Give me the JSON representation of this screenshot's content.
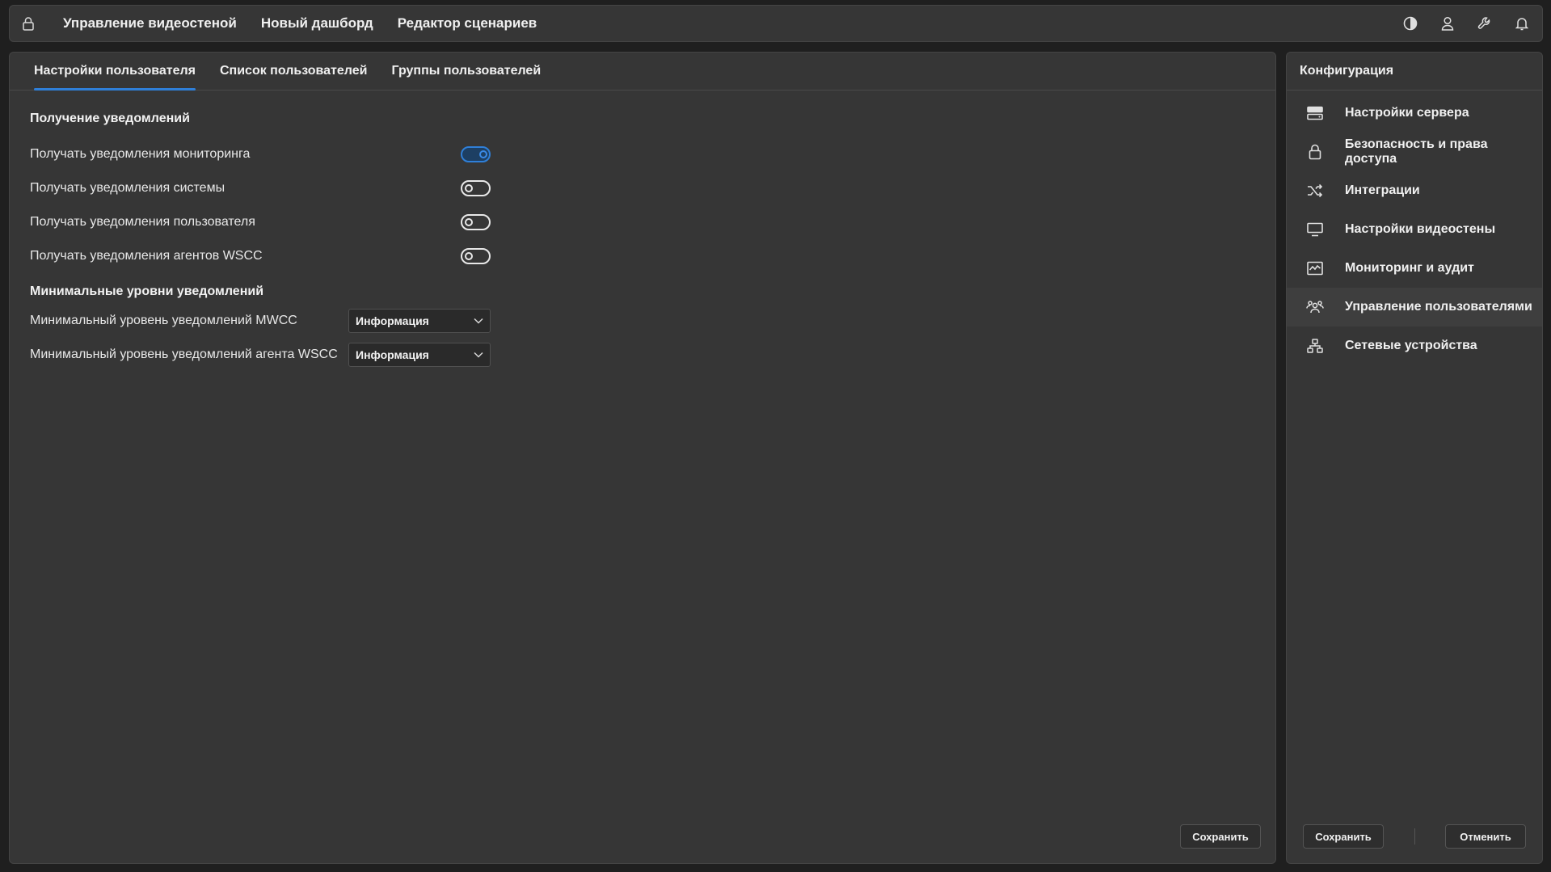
{
  "topbar": {
    "nav": [
      "Управление видеостеной",
      "Новый дашборд",
      "Редактор сценариев"
    ]
  },
  "tabs": [
    "Настройки пользователя",
    "Список пользователей",
    "Группы пользователей"
  ],
  "notifications": {
    "title": "Получение уведомлений",
    "items": [
      {
        "label": "Получать уведомления мониторинга",
        "on": true
      },
      {
        "label": "Получать уведомления системы",
        "on": false
      },
      {
        "label": "Получать уведомления пользователя",
        "on": false
      },
      {
        "label": "Получать уведомления агентов WSCC",
        "on": false
      }
    ]
  },
  "levels": {
    "title": "Минимальные уровни уведомлений",
    "items": [
      {
        "label": "Минимальный уровень уведомлений MWCC",
        "value": "Информация"
      },
      {
        "label": "Минимальный уровень уведомлений агента WSCC",
        "value": "Информация"
      }
    ]
  },
  "main": {
    "save_label": "Сохранить"
  },
  "sidebar": {
    "title": "Конфигурация",
    "items": [
      {
        "label": "Настройки сервера",
        "icon": "server-icon"
      },
      {
        "label": "Безопасность и права доступа",
        "icon": "lock-icon"
      },
      {
        "label": "Интеграции",
        "icon": "shuffle-icon"
      },
      {
        "label": "Настройки видеостены",
        "icon": "monitor-icon"
      },
      {
        "label": "Мониторинг и аудит",
        "icon": "chart-icon"
      },
      {
        "label": "Управление пользователями",
        "icon": "users-icon"
      },
      {
        "label": "Сетевые устройства",
        "icon": "network-icon"
      }
    ],
    "save_label": "Сохранить",
    "cancel_label": "Отменить"
  }
}
